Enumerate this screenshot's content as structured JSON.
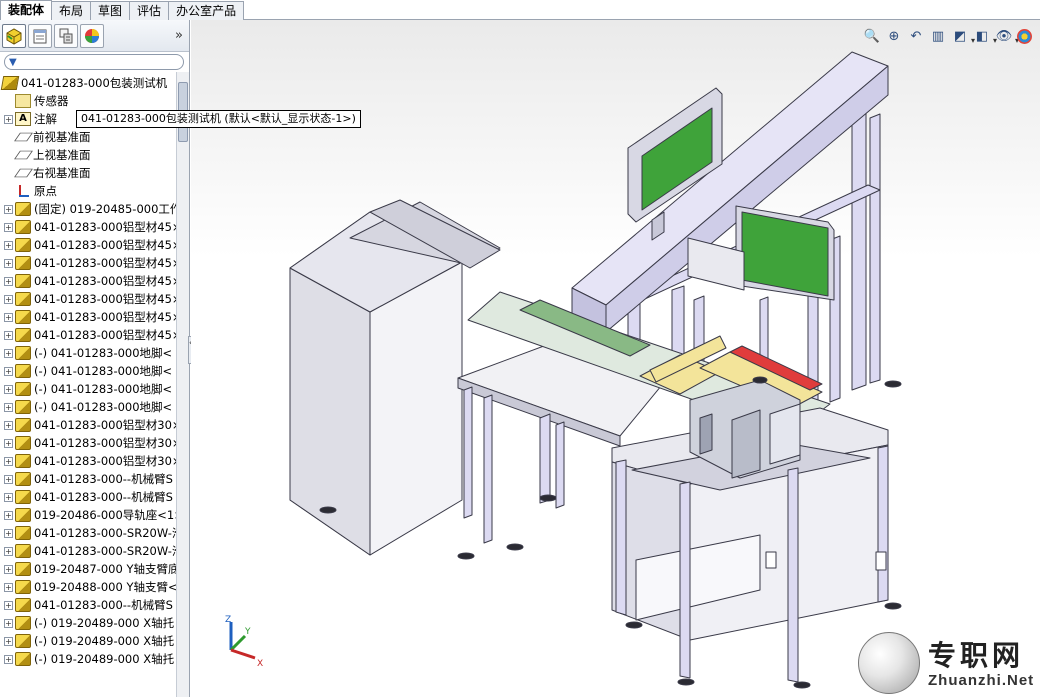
{
  "tabs": [
    {
      "label": "装配体",
      "active": true
    },
    {
      "label": "布局",
      "active": false
    },
    {
      "label": "草图",
      "active": false
    },
    {
      "label": "评估",
      "active": false
    },
    {
      "label": "办公室产品",
      "active": false
    }
  ],
  "panel": {
    "tab_icons": [
      "feature-manager-icon",
      "property-manager-icon",
      "configuration-manager-icon",
      "display-manager-icon"
    ],
    "collapse_glyph": "»",
    "filter_glyph": "▼"
  },
  "tree": {
    "root": "041-01283-000包装测试机",
    "items": [
      {
        "label": "传感器",
        "icon": "sensor-icon",
        "expand": ""
      },
      {
        "label": "注解",
        "icon": "annotation-icon",
        "expand": "+"
      },
      {
        "label": "前视基准面",
        "icon": "plane-icon",
        "expand": ""
      },
      {
        "label": "上视基准面",
        "icon": "plane-icon",
        "expand": ""
      },
      {
        "label": "右视基准面",
        "icon": "plane-icon",
        "expand": ""
      },
      {
        "label": "原点",
        "icon": "origin-icon",
        "expand": ""
      },
      {
        "label": "(固定) 019-20485-000工作",
        "icon": "part-icon",
        "expand": "+"
      },
      {
        "label": "041-01283-000铝型材45×",
        "icon": "part-icon",
        "expand": "+"
      },
      {
        "label": "041-01283-000铝型材45×",
        "icon": "part-icon",
        "expand": "+"
      },
      {
        "label": "041-01283-000铝型材45×",
        "icon": "part-icon",
        "expand": "+"
      },
      {
        "label": "041-01283-000铝型材45×",
        "icon": "part-icon",
        "expand": "+"
      },
      {
        "label": "041-01283-000铝型材45×",
        "icon": "part-icon",
        "expand": "+"
      },
      {
        "label": "041-01283-000铝型材45×",
        "icon": "part-icon",
        "expand": "+"
      },
      {
        "label": "041-01283-000铝型材45×",
        "icon": "part-icon",
        "expand": "+"
      },
      {
        "label": "(-) 041-01283-000地脚<",
        "icon": "part-icon",
        "expand": "+"
      },
      {
        "label": "(-) 041-01283-000地脚<",
        "icon": "part-icon",
        "expand": "+"
      },
      {
        "label": "(-) 041-01283-000地脚<",
        "icon": "part-icon",
        "expand": "+"
      },
      {
        "label": "(-) 041-01283-000地脚<",
        "icon": "part-icon",
        "expand": "+"
      },
      {
        "label": "041-01283-000铝型材30×",
        "icon": "part-icon",
        "expand": "+"
      },
      {
        "label": "041-01283-000铝型材30×",
        "icon": "part-icon",
        "expand": "+"
      },
      {
        "label": "041-01283-000铝型材30×",
        "icon": "part-icon",
        "expand": "+"
      },
      {
        "label": "041-01283-000--机械臂S",
        "icon": "part-icon",
        "expand": "+"
      },
      {
        "label": "041-01283-000--机械臂S",
        "icon": "part-icon",
        "expand": "+"
      },
      {
        "label": "019-20486-000导轨座<1>",
        "icon": "part-icon",
        "expand": "+"
      },
      {
        "label": "041-01283-000-SR20W-滑",
        "icon": "part-icon",
        "expand": "+"
      },
      {
        "label": "041-01283-000-SR20W-滑",
        "icon": "part-icon",
        "expand": "+"
      },
      {
        "label": "019-20487-000 Y轴支臂底",
        "icon": "part-icon",
        "expand": "+"
      },
      {
        "label": "019-20488-000 Y轴支臂<",
        "icon": "part-icon",
        "expand": "+"
      },
      {
        "label": "041-01283-000--机械臂S",
        "icon": "part-icon",
        "expand": "+"
      },
      {
        "label": "(-) 019-20489-000 X轴托",
        "icon": "part-icon",
        "expand": "+"
      },
      {
        "label": "(-) 019-20489-000 X轴托",
        "icon": "part-icon",
        "expand": "+"
      },
      {
        "label": "(-) 019-20489-000 X轴托",
        "icon": "part-icon",
        "expand": "+"
      }
    ]
  },
  "tooltip": "041-01283-000包装测试机  (默认<默认_显示状态-1>)",
  "hud": {
    "icons": [
      "zoom-to-fit-icon",
      "zoom-area-icon",
      "previous-view-icon",
      "section-view-icon",
      "view-orientation-icon",
      "display-style-icon",
      "hide-show-items-icon",
      "edit-appearance-icon",
      "apply-scene-icon",
      "view-settings-icon"
    ]
  },
  "triad": {
    "x": "X",
    "y": "Y",
    "z": "Z"
  },
  "watermark": {
    "title": "专职网",
    "url": "Zhuanzhi.Net"
  },
  "colors": {
    "frame_purple": "#dcdaf2",
    "frame_outline": "#3a3a48",
    "screen_green": "#3fa33a",
    "cover_grey": "#e9e9ef",
    "accent_red": "#e03c3c",
    "accent_yellow": "#f3e49a"
  }
}
